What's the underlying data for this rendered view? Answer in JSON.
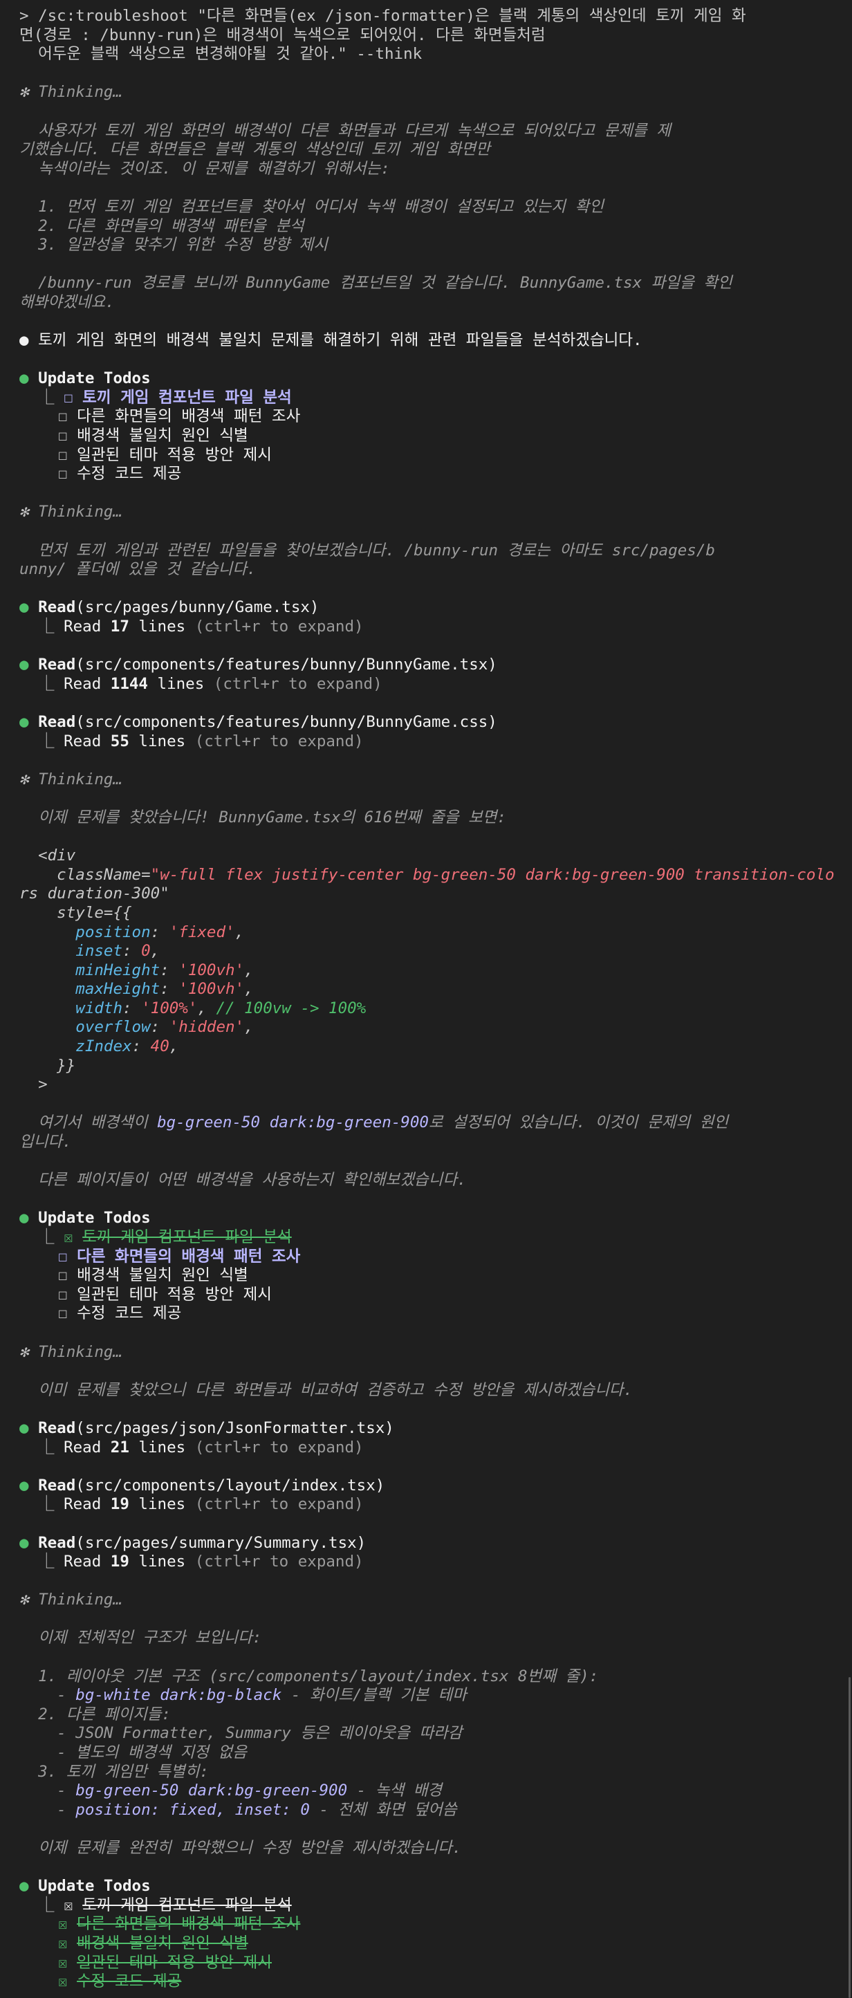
{
  "prompt": {
    "line1": "> /sc:troubleshoot \"다른 화면들(ex /json-formatter)은 블랙 계통의 색상인데 토끼 게임 화",
    "line2": "면(경로 : /bunny-run)은 배경색이 녹색으로 되어있어. 다른 화면들처럼",
    "line3": "  어두운 블랙 색상으로 변경해야될 것 같아.\" --think"
  },
  "thinking_label": "Thinking…",
  "thinking1": {
    "l1": "  사용자가 토끼 게임 화면의 배경색이 다른 화면들과 다르게 녹색으로 되어있다고 문제를 제",
    "l2": "기했습니다. 다른 화면들은 블랙 계통의 색상인데 토끼 게임 화면만",
    "l3": "  녹색이라는 것이죠. 이 문제를 해결하기 위해서는:",
    "steps": [
      "  1. 먼저 토끼 게임 컴포넌트를 찾아서 어디서 녹색 배경이 설정되고 있는지 확인",
      "  2. 다른 화면들의 배경색 패턴을 분석",
      "  3. 일관성을 맞추기 위한 수정 방향 제시"
    ],
    "l4": "  /bunny-run 경로를 보니까 BunnyGame 컴포넌트일 것 같습니다. BunnyGame.tsx 파일을 확인",
    "l5": "해봐야겠네요."
  },
  "announce": "토끼 게임 화면의 배경색 불일치 문제를 해결하기 위해 관련 파일들을 분석하겠습니다.",
  "todos_title": "Update Todos",
  "todo_items": [
    "토끼 게임 컴포넌트 파일 분석",
    "다른 화면들의 배경색 패턴 조사",
    "배경색 불일치 원인 식별",
    "일관된 테마 적용 방안 제시",
    "수정 코드 제공"
  ],
  "checkbox_empty": "☐",
  "checkbox_done": "☒",
  "tree_branch": "⎿",
  "thinking2": {
    "l1": "  먼저 토끼 게임과 관련된 파일들을 찾아보겠습니다. /bunny-run 경로는 아마도 src/pages/b",
    "l2": "unny/ 폴더에 있을 것 같습니다."
  },
  "read_label": "Read",
  "read_prefix": "Read ",
  "read_suffix": " lines",
  "expand_hint": " (ctrl+r to expand)",
  "reads1": [
    {
      "path": "(src/pages/bunny/Game.tsx)",
      "lines": "17"
    },
    {
      "path": "(src/components/features/bunny/BunnyGame.tsx)",
      "lines": "1144"
    },
    {
      "path": "(src/components/features/bunny/BunnyGame.css)",
      "lines": "55"
    }
  ],
  "thinking3": {
    "intro": "  이제 문제를 찾았습니다! BunnyGame.tsx의 616번째 줄을 보면:",
    "div_open": "  <div",
    "classname_key": "    className=",
    "classname_val1": "\"w-full flex justify-center bg-green-50 dark:bg-green-900 transition-colo",
    "classname_val2": "rs duration-300\"",
    "style_open": "    style={{",
    "props": [
      {
        "key": "position",
        "val": "'fixed'",
        "comment": ""
      },
      {
        "key": "inset",
        "val": "0",
        "comment": ""
      },
      {
        "key": "minHeight",
        "val": "'100vh'",
        "comment": ""
      },
      {
        "key": "maxHeight",
        "val": "'100vh'",
        "comment": ""
      },
      {
        "key": "width",
        "val": "'100%'",
        "comment": "// 100vw -> 100%"
      },
      {
        "key": "overflow",
        "val": "'hidden'",
        "comment": ""
      },
      {
        "key": "zIndex",
        "val": "40",
        "comment": ""
      }
    ],
    "style_close": "    }}",
    "gt": "  >",
    "expl_pre": "  여기서 배경색이 ",
    "expl_code": "bg-green-50 dark:bg-green-900",
    "expl_post": "로 설정되어 있습니다. 이것이 문제의 원인",
    "expl_l2": "입니다.",
    "next": "  다른 페이지들이 어떤 배경색을 사용하는지 확인해보겠습니다."
  },
  "thinking4": "  이미 문제를 찾았으니 다른 화면들과 비교하여 검증하고 수정 방안을 제시하겠습니다.",
  "reads2": [
    {
      "path": "(src/pages/json/JsonFormatter.tsx)",
      "lines": "21"
    },
    {
      "path": "(src/components/layout/index.tsx)",
      "lines": "19"
    },
    {
      "path": "(src/pages/summary/Summary.tsx)",
      "lines": "19"
    }
  ],
  "thinking5": {
    "intro": "  이제 전체적인 구조가 보입니다:",
    "s1": "  1. 레이아웃 기본 구조 (src/components/layout/index.tsx 8번째 줄):",
    "s1a_code": "bg-white dark:bg-black",
    "s1a_text": " - 화이트/블랙 기본 테마",
    "s2": "  2. 다른 페이지들:",
    "s2a": "    - JSON Formatter, Summary 등은 레이아웃을 따라감",
    "s2b": "    - 별도의 배경색 지정 없음",
    "s3": "  3. 토끼 게임만 특별히:",
    "s3a_code": "bg-green-50 dark:bg-green-900",
    "s3a_text": " - 녹색 배경",
    "s3b_code": "position: fixed, inset: 0",
    "s3b_text": " - 전체 화면 덮어씀",
    "dash": "    - ",
    "final": "  이제 문제를 완전히 파악했으니 수정 방안을 제시하겠습니다."
  },
  "colors": {
    "background": "#1f1f1f",
    "bullet_green": "#4fbf6b",
    "lavender": "#b9b6ff",
    "pink": "#ef6f78",
    "cyan": "#5fb8e6"
  },
  "icons": {
    "bullet": "●",
    "thinking": "✻"
  }
}
